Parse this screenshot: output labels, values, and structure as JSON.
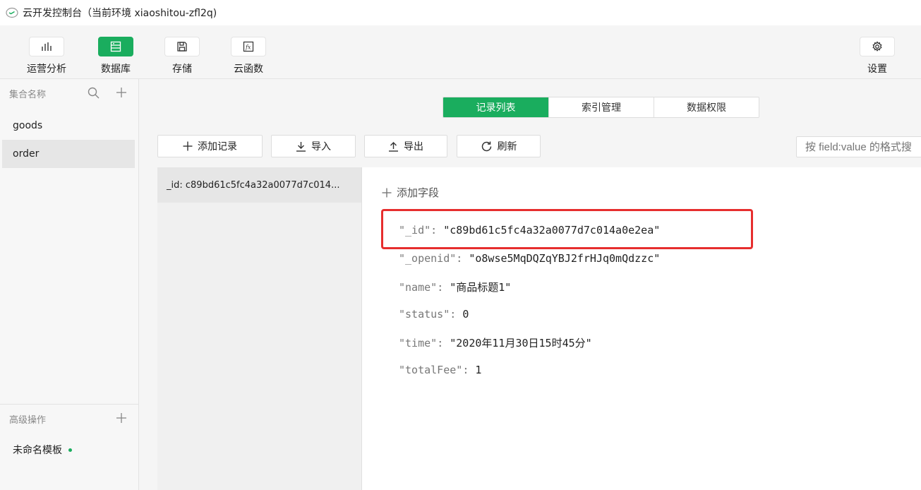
{
  "window": {
    "title": "云开发控制台（当前环境 xiaoshitou-zfl2q)"
  },
  "toolbar": {
    "items": [
      {
        "label": "运营分析",
        "icon": "bar-chart-icon"
      },
      {
        "label": "数据库",
        "icon": "database-icon"
      },
      {
        "label": "存储",
        "icon": "save-icon"
      },
      {
        "label": "云函数",
        "icon": "function-icon"
      }
    ],
    "settings_label": "设置"
  },
  "sidebar": {
    "collections_header": "集合名称",
    "collections": [
      "goods",
      "order"
    ],
    "selected_collection": "order",
    "advanced_header": "高级操作",
    "template": "未命名模板"
  },
  "tabs": [
    "记录列表",
    "索引管理",
    "数据权限"
  ],
  "active_tab": "记录列表",
  "actions": {
    "add_record": "添加记录",
    "import": "导入",
    "export": "导出",
    "refresh": "刷新"
  },
  "search": {
    "placeholder": "按 field:value 的格式搜"
  },
  "records": [
    "_id: c89bd61c5fc4a32a0077d7c014..."
  ],
  "detail": {
    "add_field": "添加字段",
    "fields": [
      {
        "key": "\"_id\"",
        "value": "\"c89bd61c5fc4a32a0077d7c014a0e2ea\""
      },
      {
        "key": "\"_openid\"",
        "value": "\"o8wse5MqDQZqYBJ2frHJq0mQdzzc\""
      },
      {
        "key": "\"name\"",
        "value": "\"商品标题1\""
      },
      {
        "key": "\"status\"",
        "value": "0"
      },
      {
        "key": "\"time\"",
        "value": "\"2020年11月30日15时45分\""
      },
      {
        "key": "\"totalFee\"",
        "value": "1"
      }
    ]
  },
  "colors": {
    "accent": "#1aad5e",
    "highlight": "#e62e2e"
  }
}
